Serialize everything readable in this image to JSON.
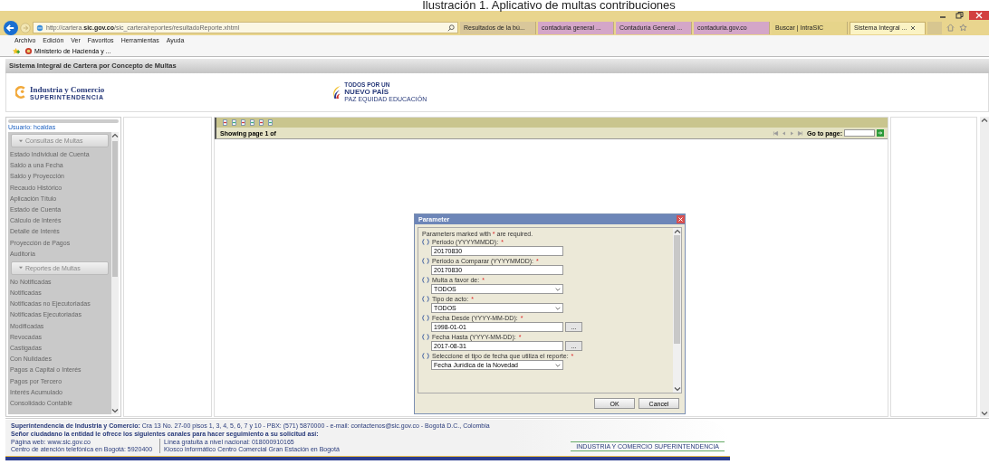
{
  "caption": "Ilustración 1. Aplicativo de multas contribuciones",
  "browser": {
    "url_pre": "http://cartera.",
    "url_bold": "sic.gov.co",
    "url_post": "/sic_cartera/reportes/resultadoReporte.xhtml",
    "tabs": [
      {
        "label": "Resultados de la bú...",
        "selected": false,
        "color": "#d9c79a"
      },
      {
        "label": "contaduria general ...",
        "selected": false,
        "color": "#d4a6c8"
      },
      {
        "label": "Contaduría General ...",
        "selected": false,
        "color": "#d4a6c8"
      },
      {
        "label": "contaduria.gov.co",
        "selected": false,
        "color": "#d4a6c8"
      },
      {
        "label": "Buscar | IntraSIC",
        "selected": false,
        "color": "#e6d48a"
      },
      {
        "label": "Sistema Integral ...",
        "selected": true,
        "color": "#fbf3c4"
      }
    ],
    "menu": [
      "Archivo",
      "Edición",
      "Ver",
      "Favoritos",
      "Herramientas",
      "Ayuda"
    ],
    "favorite": "Ministerio de Hacienda y ..."
  },
  "app_title": "Sistema Integral de Cartera por Concepto de Multas",
  "header": {
    "sic_name": "Industria y Comercio",
    "sic_sub": "SUPERINTENDENCIA",
    "gov_1": "TODOS POR UN",
    "gov_2": "NUEVO PAÍS",
    "gov_3": "PAZ  EQUIDAD  EDUCACIÓN"
  },
  "user": "Usuario: hcaldas",
  "menu_groups": [
    {
      "title": "Consultas de Multas",
      "expanded": true,
      "items": [
        "Estado Individual de Cuenta",
        "Saldo a una Fecha",
        "Saldo y Proyección",
        "Recaudo Histórico",
        "Aplicación Título",
        "Estado de Cuenta",
        "Cálculo de Interés",
        "Detalle de Interés",
        "Proyección de Pagos",
        "Auditoría"
      ]
    },
    {
      "title": "Reportes de Multas",
      "expanded": true,
      "items": [
        "No Notificadas",
        "Notificadas",
        "Notificadas no Ejecutoriadas",
        "Notificadas Ejecutoriadas",
        "Modificadas",
        "Revocadas",
        "Castigadas",
        "Con Nulidades",
        "Pagos a Capital o Interés",
        "Pagos por Tercero",
        "Interés Acumulado",
        "Consolidado Contable"
      ]
    }
  ],
  "report": {
    "showing": "Showing page  1  of",
    "goto": "Go to page:"
  },
  "dialog": {
    "title": "Parameter",
    "note_start": "Parameters marked with",
    "note_mark": "*",
    "note_end": "are required.",
    "params": [
      {
        "label": "Periodo (YYYYMMDD):",
        "required": true,
        "kind": "text",
        "value": "20170830"
      },
      {
        "label": "Periodo a Comparar (YYYYMMDD):",
        "required": true,
        "kind": "text",
        "value": "20170830"
      },
      {
        "label": "Multa a favor de:",
        "required": true,
        "kind": "select",
        "value": "TODOS"
      },
      {
        "label": "Tipo de acto:",
        "required": true,
        "kind": "select",
        "value": "TODOS"
      },
      {
        "label": "Fecha Desde (YYYY-MM-DD):",
        "required": true,
        "kind": "date",
        "value": "1998-01-01",
        "button": "..."
      },
      {
        "label": "Fecha Hasta (YYYY-MM-DD):",
        "required": true,
        "kind": "date",
        "value": "2017-08-31",
        "button": "..."
      },
      {
        "label": "Seleccione el tipo de fecha que utiliza el reporte:",
        "required": true,
        "kind": "select",
        "value": "Fecha Jurídica de la Novedad"
      }
    ],
    "buttons": [
      "OK",
      "Cancel"
    ]
  },
  "footer": {
    "line1_bold": "Superintendencia de Industria y Comercio:",
    "line1": "Cra 13 No. 27-00 pisos 1, 3, 4, 5, 6, 7 y 10 - PBX: (571) 5870000  -  e-mail: contactenos@sic.gov.co - Bogotá D.C., Colombia",
    "line2": "Señor ciudadano la entidad le ofrece los siguientes canales para hacer seguimiento a su solicitud así:",
    "col1": [
      "Página web: www.sic.gov.co",
      "Centro de atención telefónica en Bogotá: 5920400"
    ],
    "col2": [
      "Línea gratuita a nivel nacional: 018000910165",
      "Kiosco informático Centro Comercial Gran Estación en Bogotá"
    ],
    "badge": "INDUSTRIA Y COMERCIO SUPERINTENDENCIA"
  }
}
